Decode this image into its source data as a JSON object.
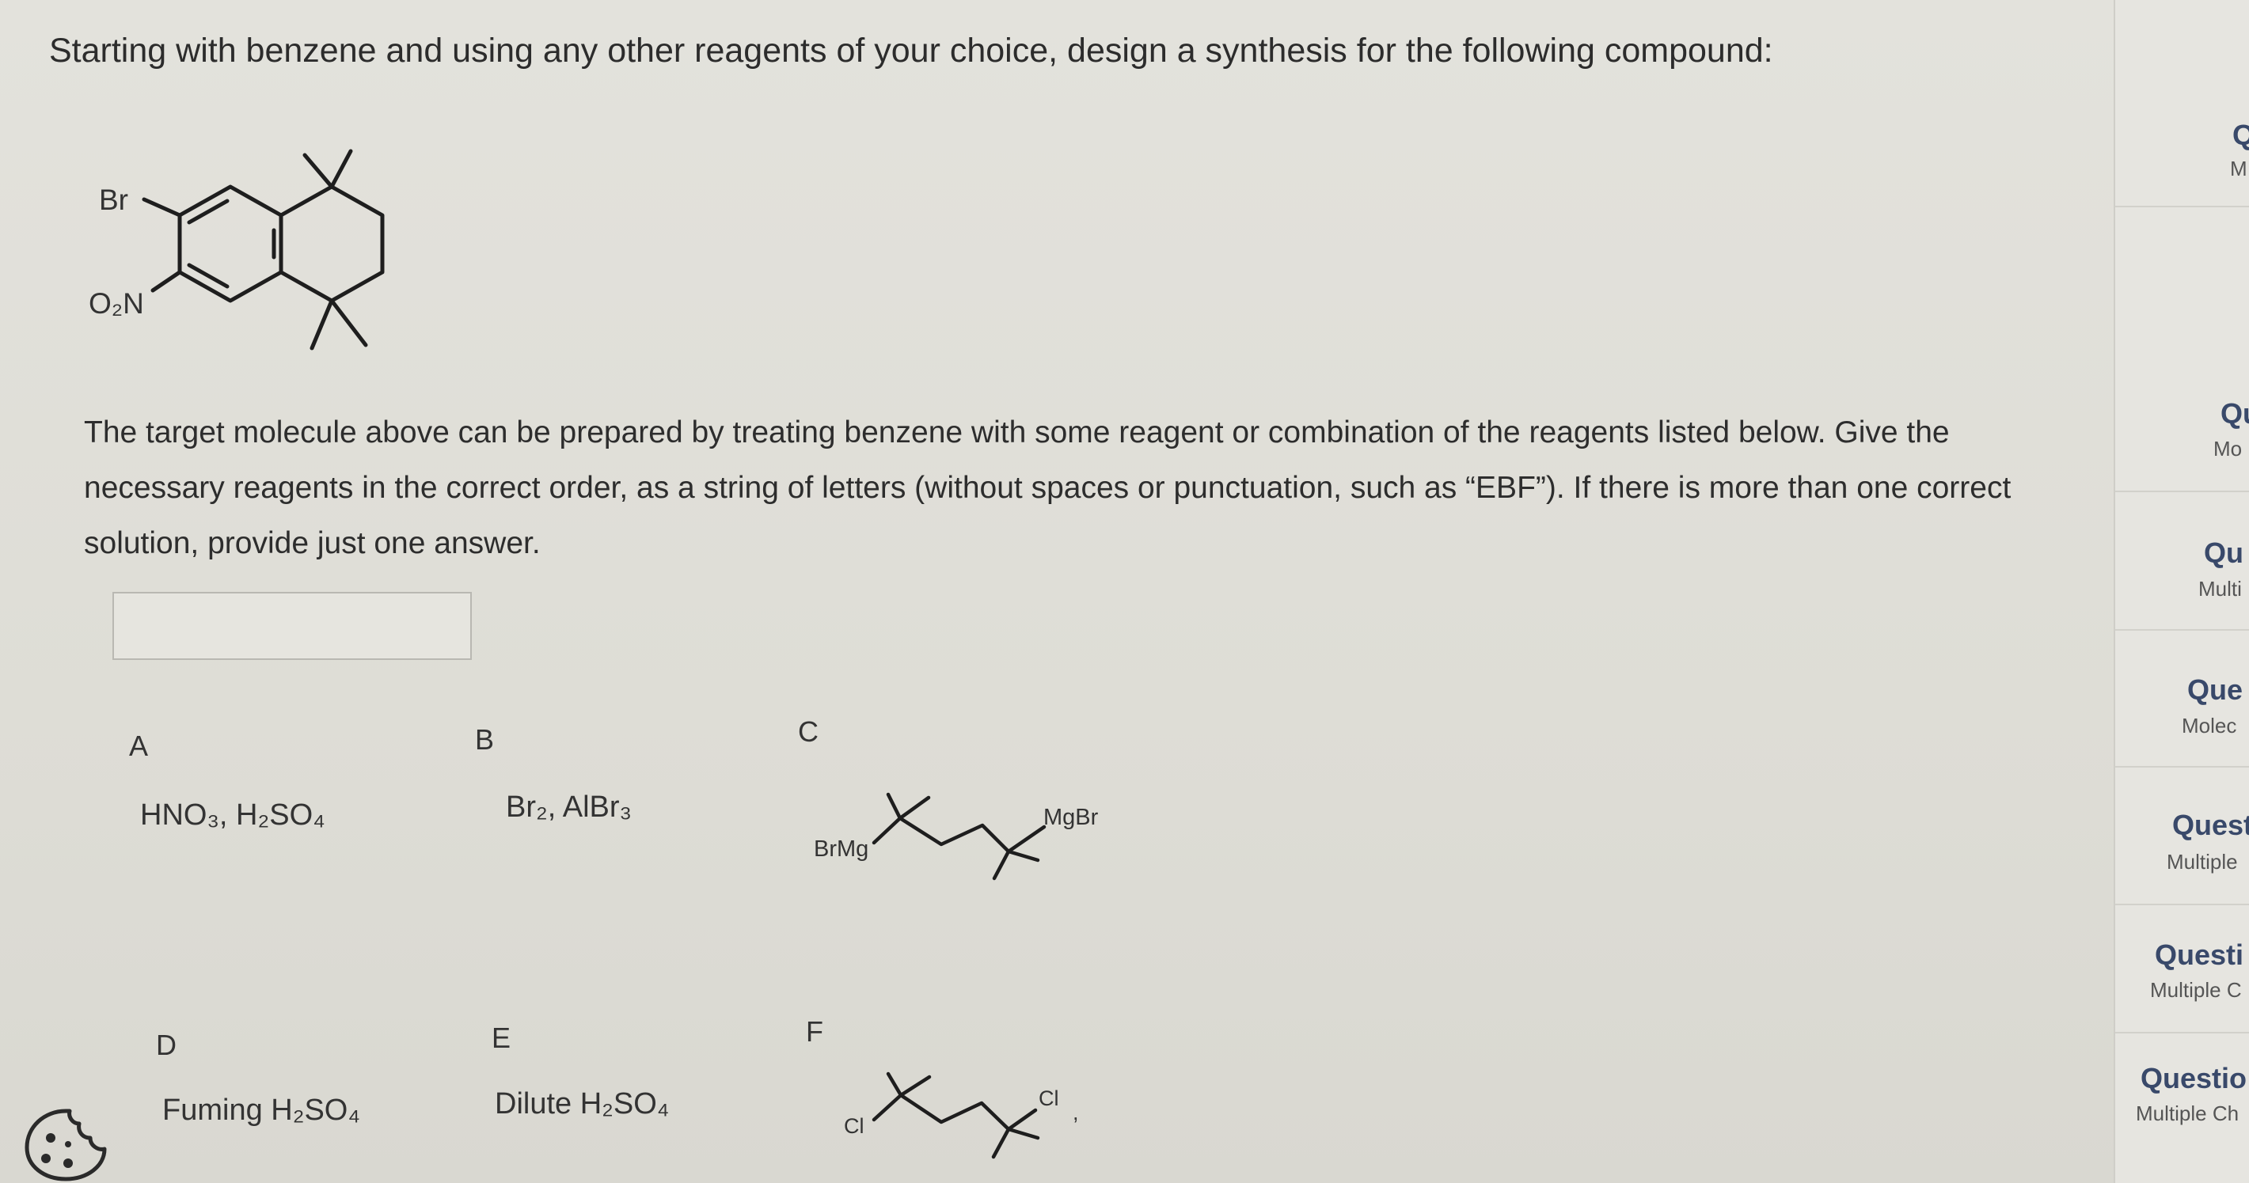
{
  "question": {
    "prompt": "Starting with benzene and using any other reagents of your choice, design a synthesis for the following compound:",
    "instructions": "The target molecule above can be prepared by treating benzene with some reagent or combination of the reagents listed below. Give the necessary reagents in the correct order, as a string of letters (without spaces or punctuation, such as “EBF”). If there is more than one correct solution, provide just one answer.",
    "answer_value": "",
    "answer_placeholder": ""
  },
  "target_molecule": {
    "labels": {
      "br": "Br",
      "nitro": "O₂N"
    }
  },
  "options": [
    {
      "letter": "A",
      "text": "HNO₃, H₂SO₄"
    },
    {
      "letter": "B",
      "text": "Br₂, AlBr₃"
    },
    {
      "letter": "C",
      "left_label": "BrMg",
      "right_label": "MgBr"
    },
    {
      "letter": "D",
      "text": "Fuming H₂SO₄"
    },
    {
      "letter": "E",
      "text": "Dilute H₂SO₄"
    },
    {
      "letter": "F",
      "left_label": "Cl",
      "right_label": "Cl"
    }
  ],
  "sidebar": {
    "items": [
      {
        "title": "Q",
        "sub": "M"
      },
      {
        "title": "Qu",
        "sub": "Mo"
      },
      {
        "title": "Qu",
        "sub": "Multi"
      },
      {
        "title": "Que",
        "sub": "Molec"
      },
      {
        "title": "Quest",
        "sub": "Multiple"
      },
      {
        "title": "Questi",
        "sub": "Multiple C"
      },
      {
        "title": "Questio",
        "sub": "Multiple Ch"
      }
    ]
  },
  "colors": {
    "background": "#e1e0da",
    "text": "#2c2c2c",
    "sidebar_title": "#39496a",
    "bond": "#1e1e1e"
  },
  "icons": {
    "cookie": "cookie-icon"
  }
}
